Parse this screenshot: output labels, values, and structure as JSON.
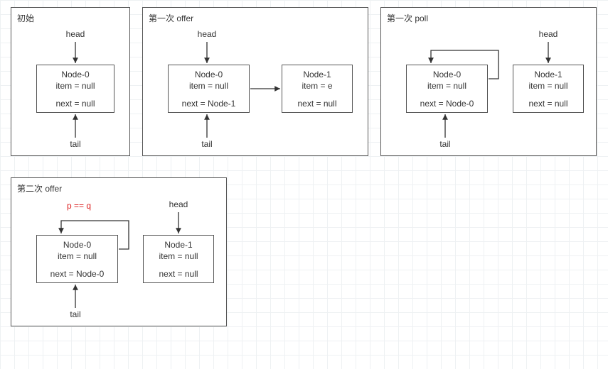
{
  "panels": {
    "p0": {
      "title": "初始",
      "head": "head",
      "tail": "tail",
      "node0": {
        "title": "Node-0",
        "item": "item = null",
        "next": "next = null"
      }
    },
    "p1": {
      "title": "第一次 offer",
      "head": "head",
      "tail": "tail",
      "node0": {
        "title": "Node-0",
        "item": "item = null",
        "next": "next = Node-1"
      },
      "node1": {
        "title": "Node-1",
        "item": "item = e",
        "next": "next = null"
      }
    },
    "p2": {
      "title": "第一次 poll",
      "head": "head",
      "tail": "tail",
      "node0": {
        "title": "Node-0",
        "item": "item = null",
        "next": "next = Node-0"
      },
      "node1": {
        "title": "Node-1",
        "item": "item = null",
        "next": "next = null"
      }
    },
    "p3": {
      "title": "第二次 offer",
      "head": "head",
      "tail": "tail",
      "pq": "p == q",
      "node0": {
        "title": "Node-0",
        "item": "item = null",
        "next": "next = Node-0"
      },
      "node1": {
        "title": "Node-1",
        "item": "item = null",
        "next": "next = null"
      }
    }
  }
}
